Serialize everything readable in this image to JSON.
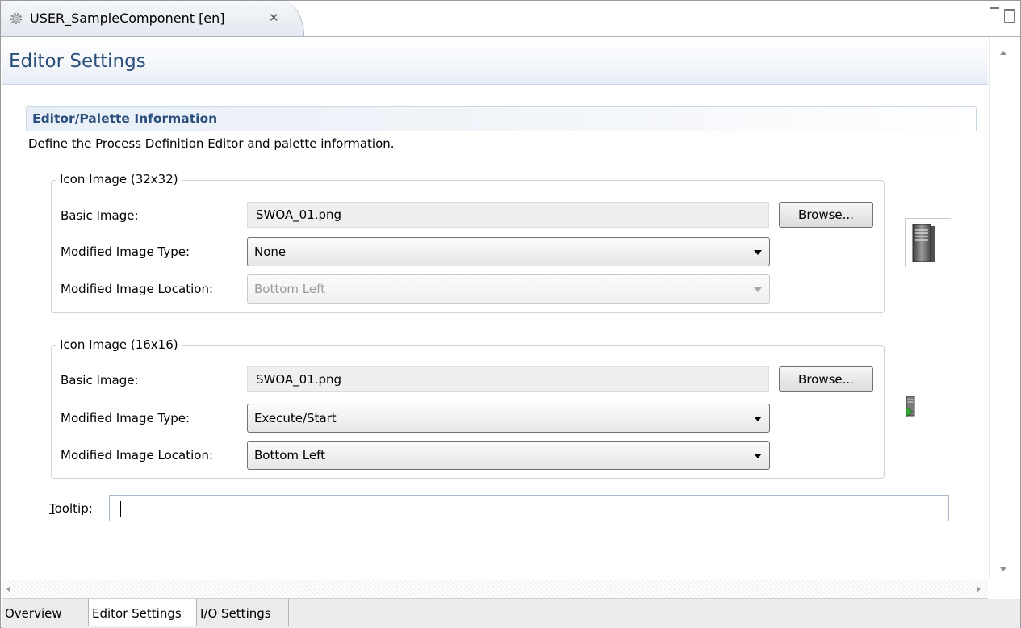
{
  "editor_tab": {
    "title": "USER_SampleComponent [en]",
    "close_glyph": "✕"
  },
  "header": {
    "title": "Editor Settings"
  },
  "section": {
    "title": "Editor/Palette Information",
    "description": "Define the Process Definition Editor and palette information."
  },
  "group32": {
    "legend": "Icon Image (32x32)",
    "basic_image_label": "Basic Image:",
    "basic_image_value": "SWOA_01.png",
    "browse_label": "Browse...",
    "mod_type_label": "Modified Image Type:",
    "mod_type_value": "None",
    "mod_loc_label": "Modified Image Location:",
    "mod_loc_value": "Bottom Left"
  },
  "group16": {
    "legend": "Icon Image (16x16)",
    "basic_image_label": "Basic Image:",
    "basic_image_value": "SWOA_01.png",
    "browse_label": "Browse...",
    "mod_type_label": "Modified Image Type:",
    "mod_type_value": "Execute/Start",
    "mod_loc_label": "Modified Image Location:",
    "mod_loc_value": "Bottom Left"
  },
  "tooltip": {
    "label_mnemonic": "T",
    "label_rest": "ooltip:",
    "value": ""
  },
  "bottom_tabs": [
    {
      "label": "Overview"
    },
    {
      "label": "Editor Settings"
    },
    {
      "label": "I/O Settings"
    }
  ],
  "icons": {
    "tab": "gear-icon",
    "preview32": "server-icon",
    "preview16": "server-run-icon"
  },
  "colors": {
    "title_blue": "#2b4f7c",
    "tab_border": "#a7b4c4",
    "run_green": "#3aa53a"
  }
}
